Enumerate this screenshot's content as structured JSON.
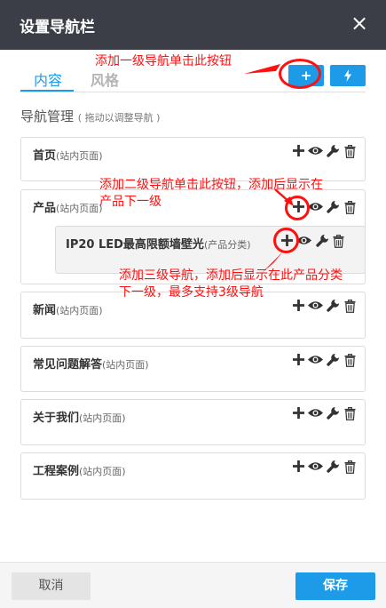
{
  "dialog": {
    "title": "设置导航栏",
    "close_glyph": "×"
  },
  "tabs": [
    {
      "label": "内容",
      "active": true
    },
    {
      "label": "风格",
      "active": false
    }
  ],
  "toolbar": {
    "add_glyph": "+",
    "bolt_icon": "lightning-icon"
  },
  "section": {
    "title": "导航管理",
    "hint": "( 拖动以调整导航 )"
  },
  "nav_items": [
    {
      "name": "首页",
      "type": "(站内页面)"
    },
    {
      "name": "产品",
      "type": "(站内页面)"
    },
    {
      "name": "新闻",
      "type": "(站内页面)"
    },
    {
      "name": "常见问题解答",
      "type": "(站内页面)"
    },
    {
      "name": "关于我们",
      "type": "(站内页面)"
    },
    {
      "name": "工程案例",
      "type": "(站内页面)"
    }
  ],
  "sub_item": {
    "name": "IP20 LED最高限额墙壁光",
    "type": "(产品分类)"
  },
  "annotations": {
    "level1": "添加一级导航单击此按钮",
    "level2_line1": "添加二级导航单击此按钮，添加后显示在",
    "level2_line2": "产品下一级",
    "level3_line1": "添加三级导航，添加后显示在此产品分类",
    "level3_line2": "下一级，最多支持3级导航"
  },
  "footer": {
    "cancel": "取消",
    "save": "保存"
  },
  "colors": {
    "header": "#3b3e47",
    "accent": "#1e9be8",
    "annotation": "#ff1010"
  }
}
